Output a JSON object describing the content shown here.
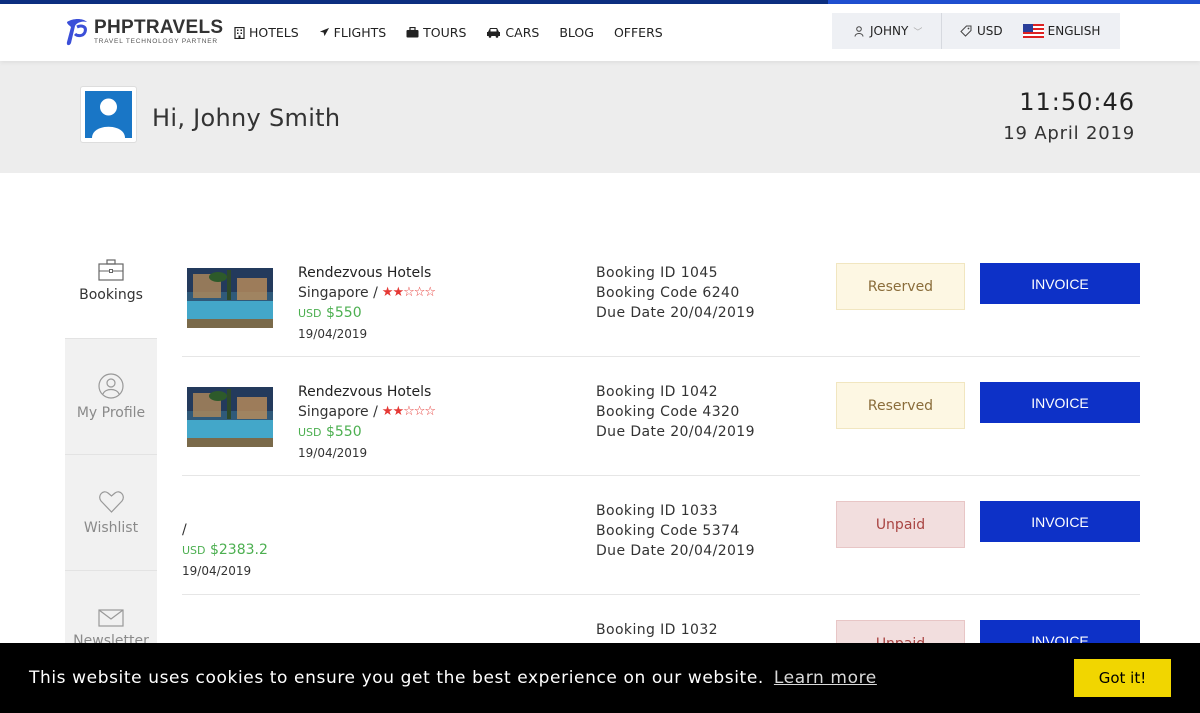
{
  "header": {
    "brand": "PHPTRAVELS",
    "tagline": "TRAVEL TECHNOLOGY PARTNER",
    "nav": [
      {
        "label": "HOTELS",
        "icon": "building-icon"
      },
      {
        "label": "FLIGHTS",
        "icon": "plane-icon"
      },
      {
        "label": "TOURS",
        "icon": "suitcase-icon"
      },
      {
        "label": "CARS",
        "icon": "car-icon"
      },
      {
        "label": "BLOG",
        "icon": ""
      },
      {
        "label": "OFFERS",
        "icon": ""
      }
    ],
    "user": "JOHNY",
    "currency": "USD",
    "language": "ENGLISH"
  },
  "greeting": {
    "text": "Hi, Johny Smith",
    "time": "11:50:46",
    "date": "19 April 2019"
  },
  "sidebar": {
    "items": [
      {
        "label": "Bookings",
        "icon": "briefcase-icon",
        "active": true
      },
      {
        "label": "My Profile",
        "icon": "user-circle-icon",
        "active": false
      },
      {
        "label": "Wishlist",
        "icon": "heart-icon",
        "active": false
      },
      {
        "label": "Newsletter",
        "icon": "envelope-icon",
        "active": false
      }
    ]
  },
  "bookings": [
    {
      "hotel": "Rendezvous Hotels",
      "location": "Singapore /",
      "stars": "★★☆☆☆",
      "currency": "USD",
      "price": "$550",
      "date": "19/04/2019",
      "booking_id": "Booking ID 1045",
      "booking_code": "Booking Code 6240",
      "due_date": "Due Date 20/04/2019",
      "status": "Reserved",
      "invoice": "INVOICE"
    },
    {
      "hotel": "Rendezvous Hotels",
      "location": "Singapore /",
      "stars": "★★☆☆☆",
      "currency": "USD",
      "price": "$550",
      "date": "19/04/2019",
      "booking_id": "Booking ID 1042",
      "booking_code": "Booking Code 4320",
      "due_date": "Due Date 20/04/2019",
      "status": "Reserved",
      "invoice": "INVOICE"
    },
    {
      "location": "/",
      "currency": "USD",
      "price": "$2383.2",
      "date": "19/04/2019",
      "booking_id": "Booking ID 1033",
      "booking_code": "Booking Code 5374",
      "due_date": "Due Date 20/04/2019",
      "status": "Unpaid",
      "invoice": "INVOICE"
    },
    {
      "booking_id": "Booking ID 1032",
      "status": "Unpaid",
      "invoice": "INVOICE"
    }
  ],
  "cookie": {
    "message": "This website uses cookies to ensure you get the best experience on our website.",
    "learn_more": "Learn more",
    "accept": "Got it!"
  },
  "colors": {
    "primary": "#0d31c7",
    "price_green": "#4caf50",
    "star_red": "#e53935",
    "cookie_button": "#f1d600"
  }
}
